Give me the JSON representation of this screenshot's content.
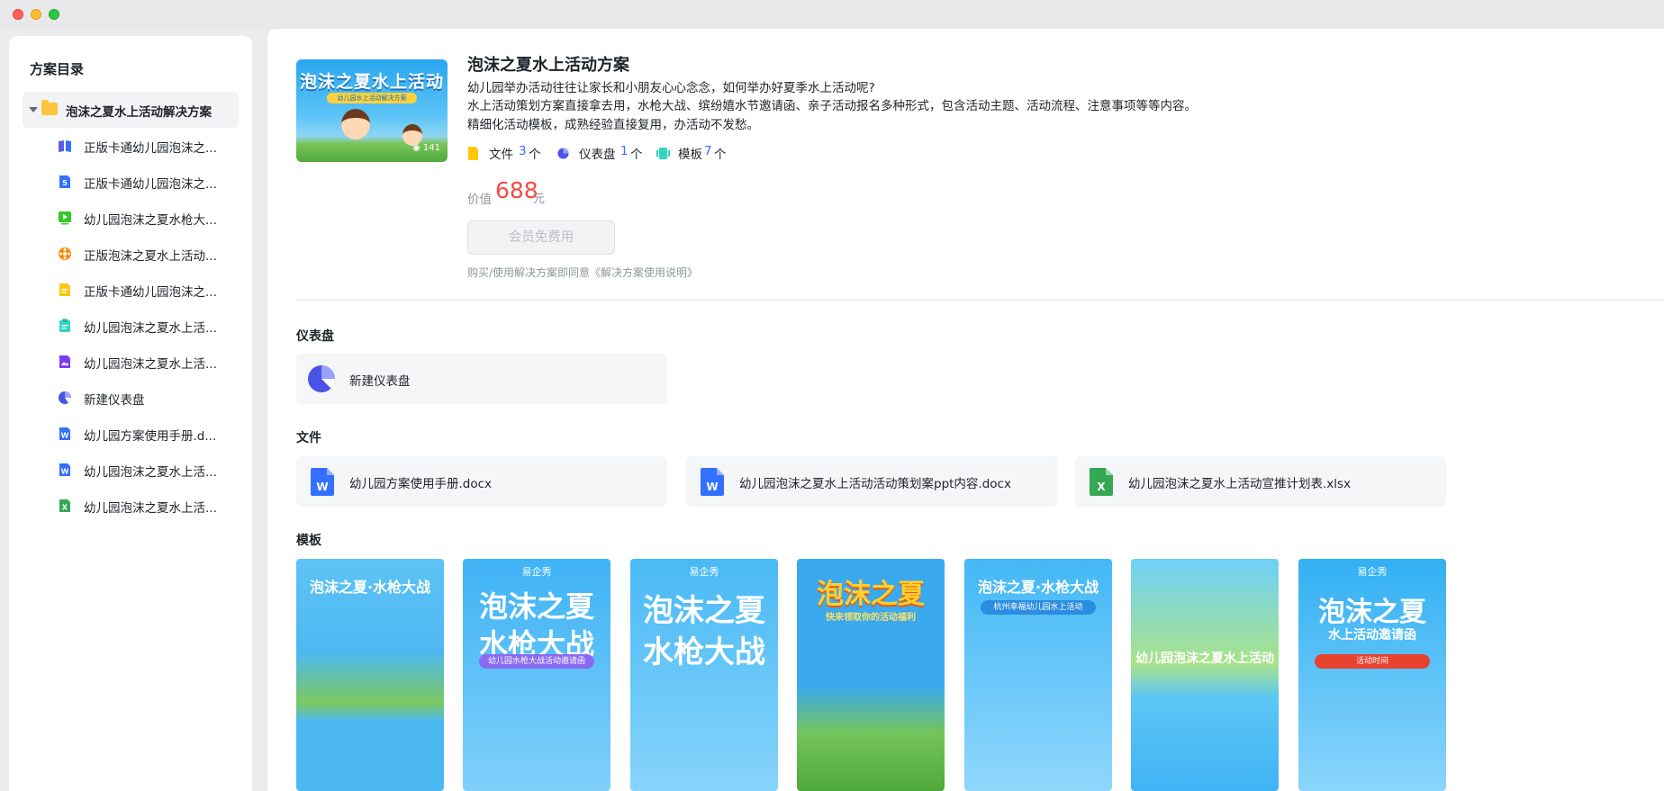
{
  "sidebar": {
    "title": "方案目录",
    "root": "泡沫之夏水上活动解决方案",
    "items": [
      {
        "label": "正版卡通幼儿园泡沫之...",
        "icon": "book-icon",
        "color": "#5b5ce6"
      },
      {
        "label": "正版卡通幼儿园泡沫之...",
        "icon": "html-file-icon",
        "color": "#3370ff"
      },
      {
        "label": "幼儿园泡沫之夏水枪大...",
        "icon": "video-icon",
        "color": "#34c724"
      },
      {
        "label": "正版泡沫之夏水上活动...",
        "icon": "flower-icon",
        "color": "#ff8800"
      },
      {
        "label": "正版卡通幼儿园泡沫之...",
        "icon": "doc-yellow-icon",
        "color": "#ffc60a"
      },
      {
        "label": "幼儿园泡沫之夏水上活...",
        "icon": "clipboard-icon",
        "color": "#33d6c0"
      },
      {
        "label": "幼儿园泡沫之夏水上活...",
        "icon": "image-icon",
        "color": "#7f3bf5"
      },
      {
        "label": "新建仪表盘",
        "icon": "dashboard-icon",
        "color": "#4954e6"
      },
      {
        "label": "幼儿园方案使用手册.d...",
        "icon": "word-icon",
        "color": "#3370ff"
      },
      {
        "label": "幼儿园泡沫之夏水上活...",
        "icon": "word-icon",
        "color": "#3370ff"
      },
      {
        "label": "幼儿园泡沫之夏水上活...",
        "icon": "excel-icon",
        "color": "#34a853"
      }
    ]
  },
  "solution": {
    "cover_title": "泡沫之夏水上活动",
    "cover_band": "幼儿园水上活动解决方案",
    "cover_views": "141",
    "title": "泡沫之夏水上活动方案",
    "desc": [
      "幼儿园举办活动往往让家长和小朋友心心念念，如何举办好夏季水上活动呢?",
      "水上活动策划方案直接拿去用，水枪大战、缤纷嬉水节邀请函、亲子活动报名多种形式，包含活动主题、活动流程、注意事项等等内容。",
      "精细化活动模板，成熟经验直接复用，办活动不发愁。"
    ],
    "stats": [
      {
        "label": "文件",
        "count": "3",
        "unit": "个",
        "color": "#ffc60a"
      },
      {
        "label": "仪表盘",
        "count": "1",
        "unit": "个",
        "color": "#4954e6"
      },
      {
        "label": "模板",
        "count": "7",
        "unit": "个",
        "color": "#33d6c0"
      }
    ],
    "price_label": "价值",
    "price": "688",
    "price_unit": "元",
    "button": "会员免费用",
    "agreement": "购买/使用解决方案即同意《解决方案使用说明》"
  },
  "sections": {
    "dashboard_title": "仪表盘",
    "dashboard_card": "新建仪表盘",
    "files_title": "文件",
    "files": [
      {
        "name": "幼儿园方案使用手册.docx",
        "type": "word",
        "letter": "W",
        "color": "#3370ff"
      },
      {
        "name": "幼儿园泡沫之夏水上活动活动策划案ppt内容.docx",
        "type": "word",
        "letter": "W",
        "color": "#3370ff"
      },
      {
        "name": "幼儿园泡沫之夏水上活动宣推计划表.xlsx",
        "type": "excel",
        "letter": "X",
        "color": "#34a853"
      }
    ],
    "templates_title": "模板",
    "templates": [
      {
        "line1": "泡沫之夏·水枪大战",
        "line2": "",
        "brand": "",
        "pill": "",
        "bg": "#4cb8f2"
      },
      {
        "line1": "泡沫之夏",
        "line2": "水枪大战",
        "brand": "易企秀",
        "pill": "幼儿园水枪大战活动邀请函",
        "bg": "#3fb3f5"
      },
      {
        "line1": "泡沫之夏",
        "line2": "水枪大战",
        "brand": "易企秀",
        "pill": "",
        "bg": "#49b9f5"
      },
      {
        "line1": "泡沫之夏",
        "line2": "",
        "brand": "",
        "pill": "快来领取你的活动福利",
        "bg": "#3aa9ee"
      },
      {
        "line1": "泡沫之夏·水枪大战",
        "line2": "",
        "brand": "",
        "pill": "杭州幸福幼儿园水上活动",
        "bg": "#43b8f6"
      },
      {
        "line1": "幼儿园泡沫之夏水上活动",
        "line2": "",
        "brand": "",
        "pill": "",
        "bg": "#5cc6f5"
      },
      {
        "line1": "泡沫之夏",
        "line2": "水上活动邀请函",
        "brand": "易企秀",
        "pill": "活动时间",
        "bg": "#33b0f3"
      }
    ]
  }
}
